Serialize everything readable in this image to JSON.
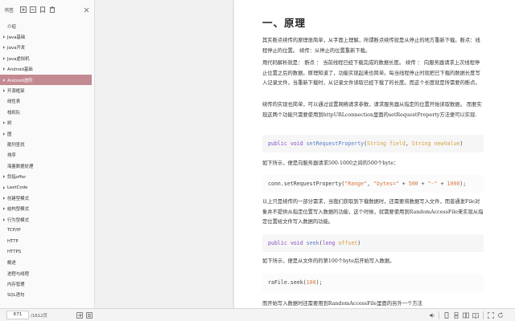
{
  "sidebar": {
    "title": "书签",
    "items": [
      {
        "label": "介绍",
        "caret": false,
        "active": false
      },
      {
        "label": "Java基础",
        "caret": true,
        "active": false
      },
      {
        "label": "Java开发",
        "caret": true,
        "active": false
      },
      {
        "label": "Java虚拟机",
        "caret": true,
        "active": false
      },
      {
        "label": "Android基础",
        "caret": true,
        "active": false
      },
      {
        "label": "Android进阶",
        "caret": true,
        "active": true
      },
      {
        "label": "开源框架",
        "caret": true,
        "active": false
      },
      {
        "label": "线性表",
        "caret": false,
        "active": false
      },
      {
        "label": "栈和队",
        "caret": false,
        "active": false
      },
      {
        "label": "树",
        "caret": true,
        "active": false
      },
      {
        "label": "图",
        "caret": true,
        "active": false
      },
      {
        "label": "散列查找",
        "caret": false,
        "active": false
      },
      {
        "label": "排序",
        "caret": false,
        "active": false
      },
      {
        "label": "海量数据处理",
        "caret": false,
        "active": false
      },
      {
        "label": "剑指offer",
        "caret": true,
        "active": false
      },
      {
        "label": "LeetCode",
        "caret": true,
        "active": false
      },
      {
        "label": "创建型模式",
        "caret": true,
        "active": false
      },
      {
        "label": "结构型模式",
        "caret": true,
        "active": false
      },
      {
        "label": "行为型模式",
        "caret": true,
        "active": false
      },
      {
        "label": "TCP/IP",
        "caret": false,
        "active": false
      },
      {
        "label": "HTTP",
        "caret": false,
        "active": false
      },
      {
        "label": "HTTPS",
        "caret": false,
        "active": false
      },
      {
        "label": "概述",
        "caret": false,
        "active": false
      },
      {
        "label": "进程与线程",
        "caret": false,
        "active": false
      },
      {
        "label": "内存管理",
        "caret": false,
        "active": false
      },
      {
        "label": "SQL语句",
        "caret": false,
        "active": false
      }
    ]
  },
  "doc": {
    "heading": "一、原理",
    "p1": "其实断点续传的原理很简单，从字面上理解，所谓断点续传就是从停止的地方重新下载。断点：线程停止的位置。 续传：从停止的位置重新下载。",
    "p2": "用代码解析就是： 断点 ： 当前线程已经下载完成的数据长度。 续传 ： 向服务器请求上次线程停止位置之后的数据。原理知道了，功能实现起来也简单。每当线程停止时就把已下载的数据长度写入记录文件，当重新下载时，从记录文件读取已经下载了的长度。而这个长度就是所需要的断点。",
    "p3": "续传的实现也简单，可以通过设置网络请求参数，请求服务器从指定的位置开始读取数据。 而要实现这两个功能只需要使用到httpURLconnection里面的setRequestProperty方法便可以实现.",
    "code1": {
      "kw1": "public",
      "kw2": "void",
      "fn": "setRequestProperty",
      "open": "(",
      "t1": "String",
      "a1": "field",
      "comma": ", ",
      "t2": "String",
      "a2": "newValue",
      "close": ")"
    },
    "p4": "如下所示，便是向服务器请求500-1000之间的500个byte：",
    "code2": {
      "pre": "conn.setRequestProperty(",
      "s1": "\"Range\"",
      "c1": ", ",
      "s2": "\"bytes=\"",
      "op1": " + ",
      "n1": "500",
      "op2": " + ",
      "s3": "\"-\"",
      "op3": " + ",
      "n2": "1000",
      "post": ");"
    },
    "p5": "以上只是续传的一部分需求，当我们获取到下载数据时，还需要将数据写入文件，而普通发File对象并不提供从指定位置写入数据的功能，这个时候，就需要使用到RandomAccessFile来实现从指定位置给文件写入数据的功能。",
    "code3": {
      "kw1": "public",
      "kw2": "void",
      "fn": "seek",
      "open": "(",
      "t1": "long",
      "a1": "offset",
      "close": ")"
    },
    "p6": "如下所示，便是从文件的的第100个byte后开始写入数据。",
    "code4": {
      "pre": "raFile.seek(",
      "n1": "100",
      "post": ");"
    },
    "p7": "而开始写入数据时还需要用到RandomAccessFile里面的另外一个方法"
  },
  "bottom": {
    "page_input": "671",
    "page_total": "/1612页"
  }
}
